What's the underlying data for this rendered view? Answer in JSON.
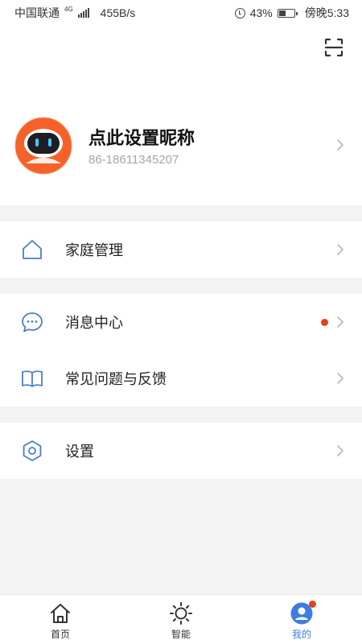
{
  "status_bar": {
    "carrier": "中国联通",
    "network": "4G",
    "speed": "455B/s",
    "battery": "43%",
    "time": "傍晚5:33"
  },
  "profile": {
    "nickname": "点此设置昵称",
    "phone": "86-18611345207"
  },
  "menu": {
    "home_management": "家庭管理",
    "message_center": "消息中心",
    "faq_feedback": "常见问题与反馈",
    "settings": "设置"
  },
  "tabs": [
    {
      "label": "首页",
      "icon": "home-icon"
    },
    {
      "label": "智能",
      "icon": "sun-icon"
    },
    {
      "label": "我的",
      "icon": "user-icon"
    }
  ],
  "colors": {
    "accent": "#3d7de1",
    "icon_blue": "#4a7fc9",
    "badge_red": "#e8401c",
    "avatar_orange": "#f4622a"
  }
}
